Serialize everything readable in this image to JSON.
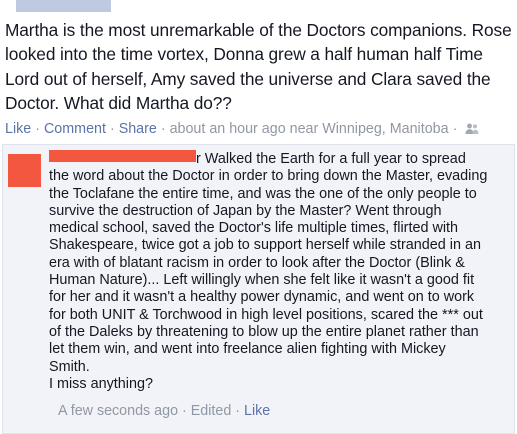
{
  "post": {
    "text": "Martha is the most unremarkable of the Doctors companions. Rose looked into the time vortex, Donna grew a half human half Time Lord out of herself, Amy saved the universe and Clara saved the Doctor. What did Martha do??"
  },
  "actions": {
    "like": "Like",
    "comment": "Comment",
    "share": "Share",
    "separator": "·",
    "meta": "about an hour ago near Winnipeg, Manitoba",
    "audience_icon": "people-icon"
  },
  "comment": {
    "text_suffix": "r Walked the Earth for a full year to spread the word about the Doctor in order to bring down the Master, evading the Toclafane the entire time, and was the one of the only people to survive the destruction of Japan by the Master? Went through medical school, saved the Doctor's life multiple times, flirted with Shakespeare, twice got a job to support herself while stranded in an era with of blatant racism in order to look after the Doctor (Blink & Human Nature)... Left willingly when she felt like it wasn't a good fit for her and it wasn't a healthy power dynamic, and went on to work for both UNIT & Torchwood in high level positions, scared the *** out of the Daleks by threatening to blow up the entire planet rather than let them win, and went into freelance alien fighting with Mickey Smith.",
    "last_line": "I miss anything?",
    "time": "A few seconds ago",
    "edited": "Edited",
    "like": "Like"
  },
  "colors": {
    "link": "#5b74a8",
    "meta": "#9197a3",
    "redaction_top": "#bfc9e0",
    "redaction_name": "#f4573f",
    "comment_bg": "#f1f3f8"
  }
}
